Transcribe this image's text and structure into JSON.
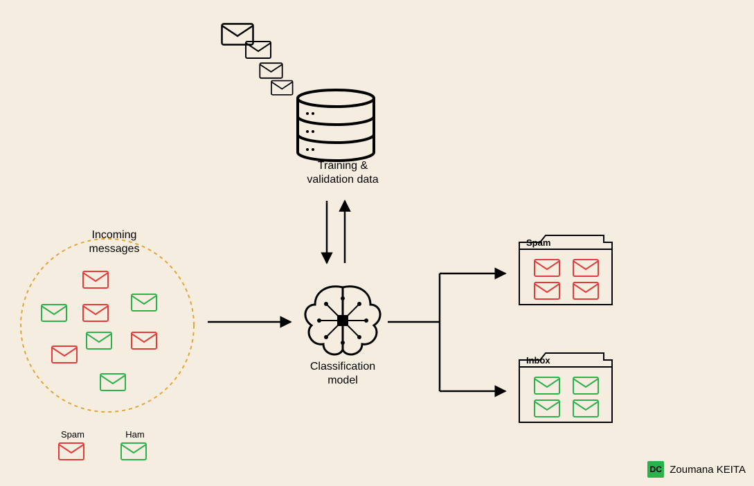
{
  "labels": {
    "training_data": "Training &\nvalidation data",
    "incoming": "Incoming\nmessages",
    "model": "Classification\nmodel",
    "folder_spam": "Spam",
    "folder_inbox": "Inbox",
    "legend_spam": "Spam",
    "legend_ham": "Ham"
  },
  "credit": {
    "badge": "DC",
    "author": "Zoumana KEITA"
  },
  "colors": {
    "spam": "#e43b3b",
    "ham": "#2bb24c",
    "circle": "#e0a63b"
  }
}
